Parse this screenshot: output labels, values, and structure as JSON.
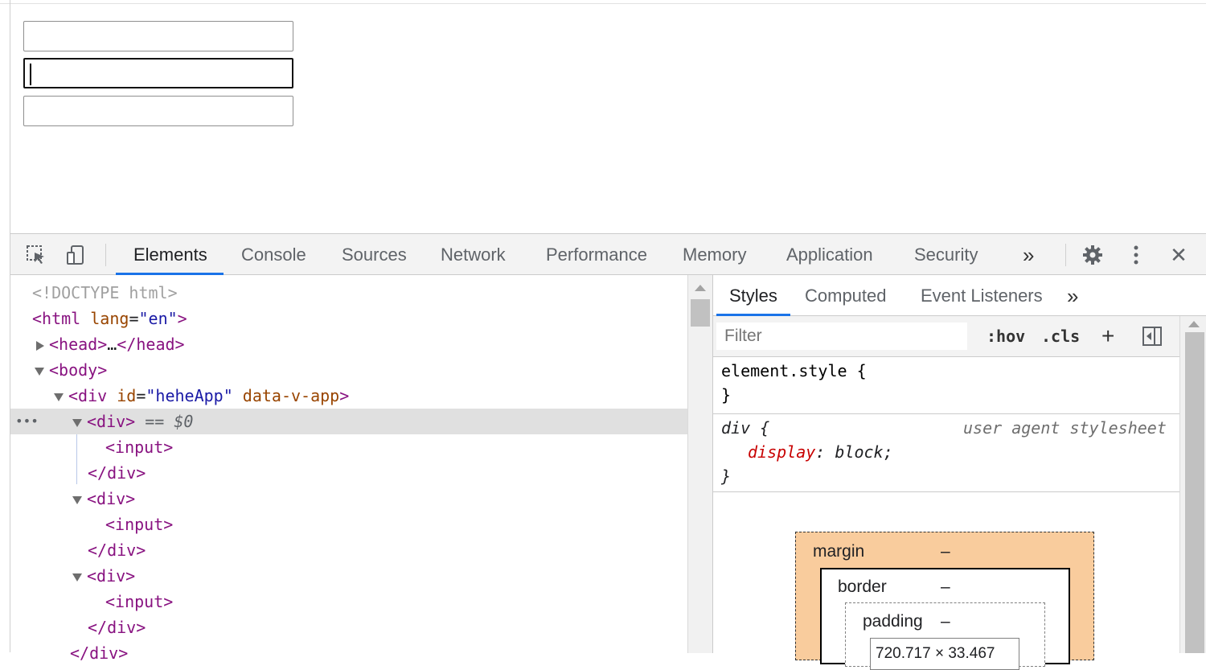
{
  "viewport": {
    "inputs": [
      {
        "value": ""
      },
      {
        "value": "",
        "focused": true
      },
      {
        "value": ""
      }
    ]
  },
  "devtools": {
    "tabs": [
      "Elements",
      "Console",
      "Sources",
      "Network",
      "Performance",
      "Memory",
      "Application",
      "Security"
    ],
    "active_tab": "Elements",
    "more_tabs": "»",
    "close": "✕",
    "dom": {
      "doctype": "<!DOCTYPE html>",
      "html_tag_open": "<html",
      "html_attr": "lang",
      "html_attr_val": "\"en\"",
      "head_open": "<head>",
      "head_ellipsis": "…",
      "head_close": "</head>",
      "body_open": "<body>",
      "app_div_open": "<div",
      "app_id_attr": "id",
      "app_id_val": "\"heheApp\"",
      "app_data_attr": "data-v-app",
      "div_open": "<div>",
      "selected_marker": "== $0",
      "input_tag": "<input>",
      "div_close": "</div>",
      "row_dots": "•••"
    },
    "styles": {
      "tabs": [
        "Styles",
        "Computed",
        "Event Listeners"
      ],
      "active_tab": "Styles",
      "more_tabs": "»",
      "filter_placeholder": "Filter",
      "hov": ":hov",
      "cls": ".cls",
      "plus": "+",
      "element_style_selector": "element.style {",
      "close_brace": "}",
      "rule_selector": "div {",
      "rule_source": "user agent stylesheet",
      "rule_prop": "display",
      "rule_val": "block;",
      "box_model": {
        "margin_label": "margin",
        "margin_value": "–",
        "border_label": "border",
        "border_value": "–",
        "padding_label": "padding",
        "padding_value": "–",
        "content_size": "720.717 × 33.467"
      }
    }
  }
}
